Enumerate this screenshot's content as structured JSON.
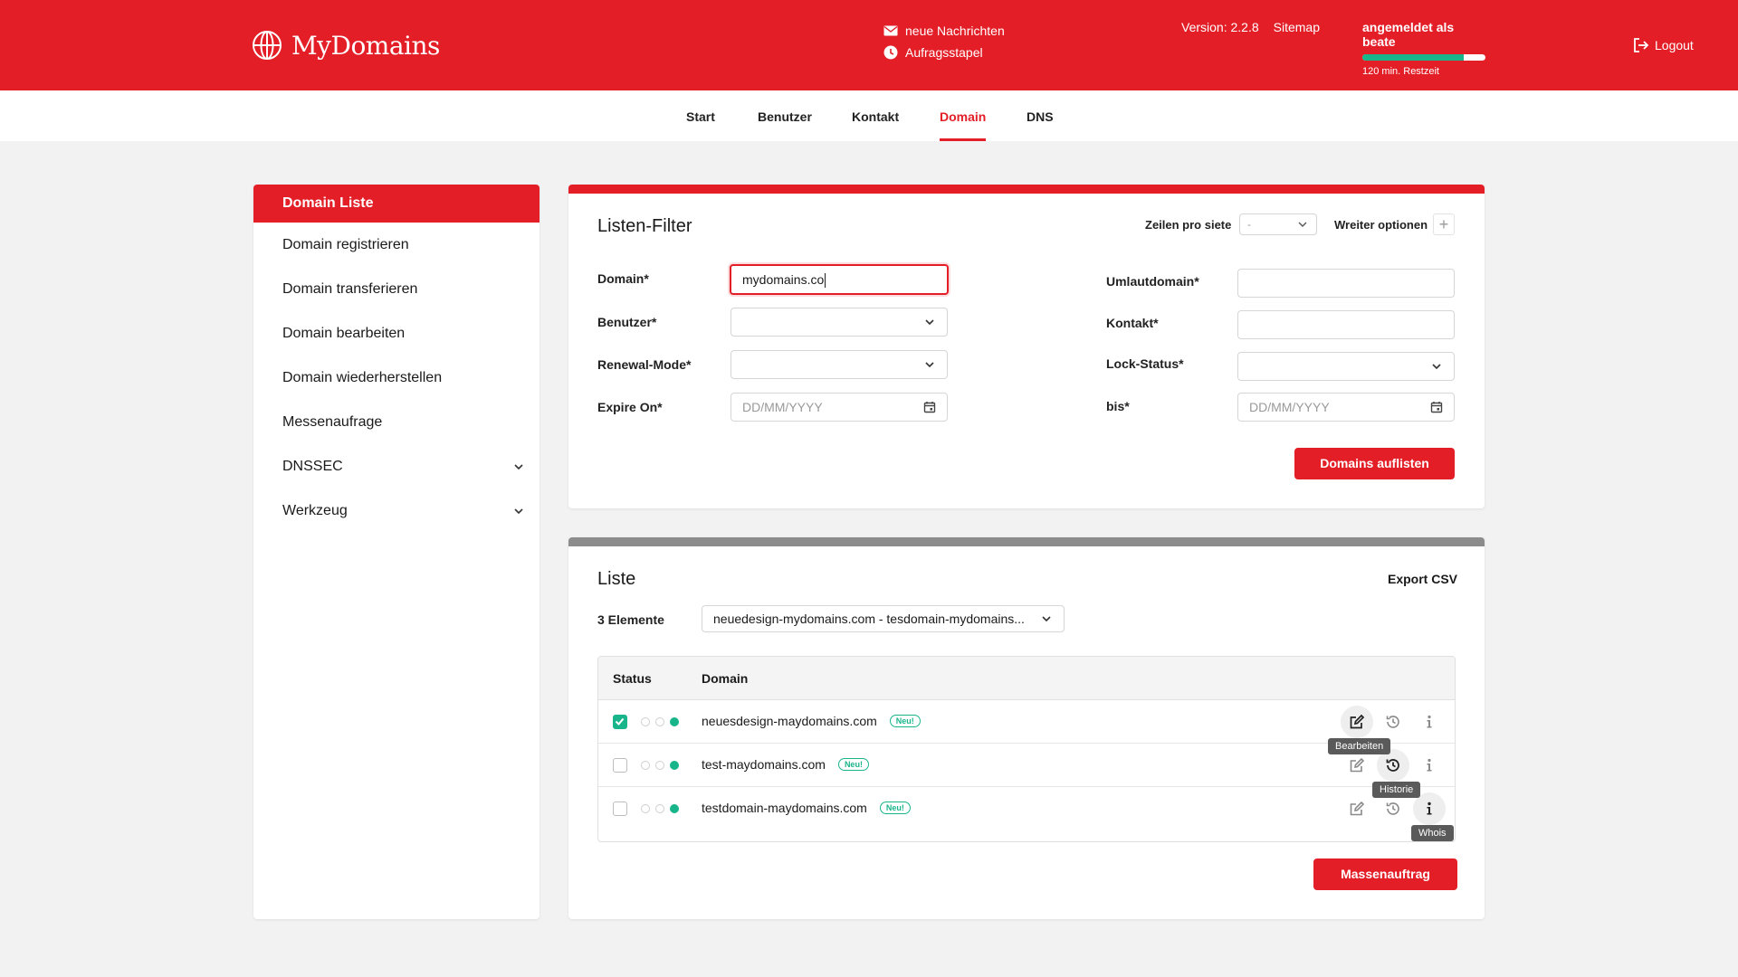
{
  "colors": {
    "brand_red": "#e31e27",
    "status_green": "#19b58a",
    "list_header_gray": "#8c8c8c"
  },
  "header": {
    "logo_text": "MyDomains",
    "logo_icon": "globe-icon",
    "messages_label": "neue Nachrichten",
    "jobs_label": "Aufragsstapel",
    "version": "Version: 2.2.8",
    "sitemap": "Sitemap",
    "session_user": "angemeldet als beate",
    "session_progress_percent": 82,
    "session_remaining": "120 min. Restzeit",
    "logout": "Logout"
  },
  "topnav": {
    "tabs": [
      {
        "label": "Start",
        "active": false
      },
      {
        "label": "Benutzer",
        "active": false
      },
      {
        "label": "Kontakt",
        "active": false
      },
      {
        "label": "Domain",
        "active": true
      },
      {
        "label": "DNS",
        "active": false
      }
    ]
  },
  "sidebar": {
    "items": [
      {
        "label": "Domain Liste",
        "active": true
      },
      {
        "label": "Domain registrieren"
      },
      {
        "label": "Domain transferieren"
      },
      {
        "label": "Domain bearbeiten"
      },
      {
        "label": "Domain wiederherstellen"
      },
      {
        "label": "Messenaufrage"
      },
      {
        "label": "DNSSEC",
        "expandable": true
      },
      {
        "label": "Werkzeug",
        "expandable": true
      }
    ]
  },
  "filter": {
    "title": "Listen-Filter",
    "rows_per_page_label": "Zeilen pro siete",
    "rows_per_page_value": "-",
    "more_options_label": "Wreiter optionen",
    "domain_label": "Domain*",
    "domain_value": "mydomains.co",
    "user_label": "Benutzer*",
    "renewal_label": "Renewal-Mode*",
    "expire_label": "Expire On*",
    "expire_placeholder": "DD/MM/YYYY",
    "umlaut_label": "Umlautdomain*",
    "contact_label": "Kontakt*",
    "lock_label": "Lock-Status*",
    "until_label": "bis*",
    "until_placeholder": "DD/MM/YYYY",
    "submit_label": "Domains auflisten"
  },
  "list": {
    "title": "Liste",
    "export_label": "Export CSV",
    "count_label": "3 Elemente",
    "selection_value": "neuedesign-mydomains.com - tesdomain-mydomains...",
    "columns": {
      "status": "Status",
      "domain": "Domain"
    },
    "rows": [
      {
        "domain": "neuesdesign-maydomains.com",
        "badge": "Neu!",
        "checked": true
      },
      {
        "domain": "test-maydomains.com",
        "badge": "Neu!",
        "checked": false
      },
      {
        "domain": "testdomain-maydomains.com",
        "badge": "Neu!",
        "checked": false
      }
    ],
    "tooltips": {
      "edit": "Bearbeiten",
      "history": "Historie",
      "whois": "Whois"
    },
    "bulk_label": "Massenauftrag"
  }
}
